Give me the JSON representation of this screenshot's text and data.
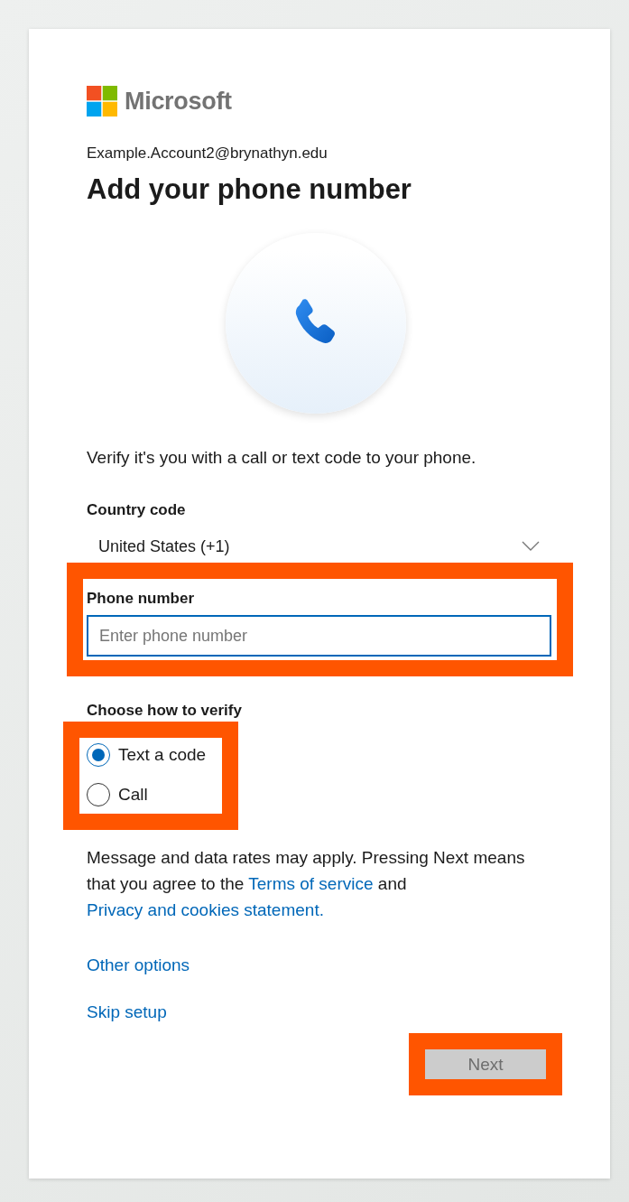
{
  "brand": "Microsoft",
  "account": "Example.Account2@brynathyn.edu",
  "title": "Add your phone number",
  "intro": "Verify it's you with a call or text code to your phone.",
  "country": {
    "label": "Country code",
    "value": "United States (+1)"
  },
  "phone": {
    "label": "Phone number",
    "placeholder": "Enter phone number",
    "highlighted": true
  },
  "verify": {
    "label": "Choose how to verify",
    "highlighted": true,
    "options": [
      {
        "label": "Text a code",
        "selected": true
      },
      {
        "label": "Call",
        "selected": false
      }
    ]
  },
  "notice": [
    {
      "kind": "text",
      "text": "Message and data rates may apply. Pressing Next means that you agree to the "
    },
    {
      "kind": "link",
      "text": "Terms of service"
    },
    {
      "kind": "text",
      "text": " and "
    },
    {
      "kind": "link",
      "text": "Privacy and cookies statement."
    }
  ],
  "links": [
    "Other options",
    "Skip setup"
  ],
  "next": {
    "label": "Next",
    "disabled": true,
    "highlighted": true
  }
}
